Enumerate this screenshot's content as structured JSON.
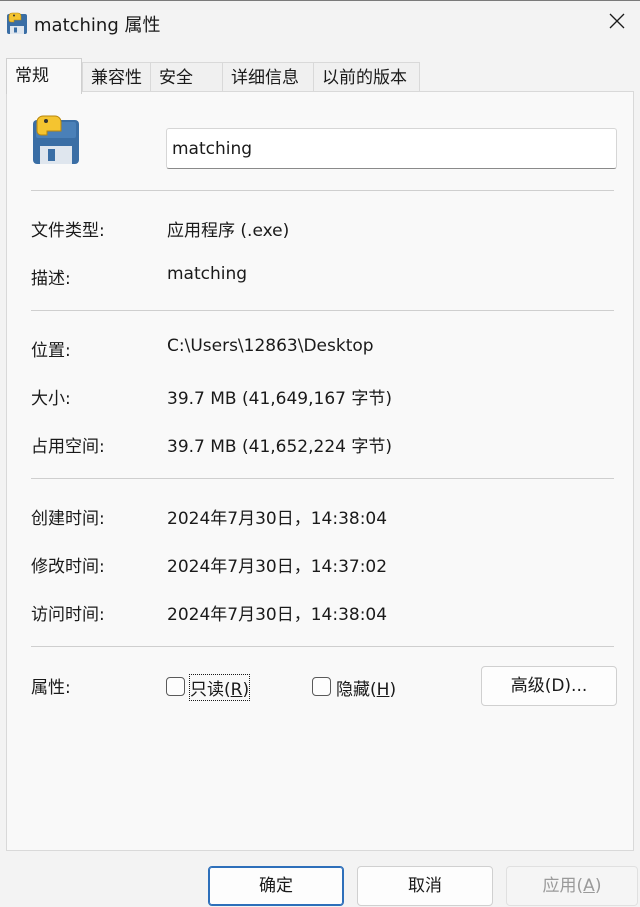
{
  "window": {
    "title": "matching 属性"
  },
  "tabs": [
    {
      "label": "常规",
      "active": true
    },
    {
      "label": "兼容性",
      "active": false
    },
    {
      "label": "安全",
      "active": false
    },
    {
      "label": "详细信息",
      "active": false
    },
    {
      "label": "以前的版本",
      "active": false
    }
  ],
  "general": {
    "file_name": "matching",
    "file_type_label": "文件类型:",
    "file_type_value": "应用程序 (.exe)",
    "description_label": "描述:",
    "description_value": "matching",
    "location_label": "位置:",
    "location_value": "C:\\Users\\12863\\Desktop",
    "size_label": "大小:",
    "size_value": "39.7 MB (41,649,167 字节)",
    "size_on_disk_label": "占用空间:",
    "size_on_disk_value": "39.7 MB (41,652,224 字节)",
    "created_label": "创建时间:",
    "created_value": "2024年7月30日，14:38:04",
    "modified_label": "修改时间:",
    "modified_value": "2024年7月30日，14:37:02",
    "accessed_label": "访问时间:",
    "accessed_value": "2024年7月30日，14:38:04",
    "attributes_label": "属性:",
    "readonly_label": "只读(",
    "readonly_key": "R",
    "readonly_end": ")",
    "readonly_checked": false,
    "hidden_label": "隐藏(",
    "hidden_key": "H",
    "hidden_end": ")",
    "hidden_checked": false,
    "advanced_button": "高级(D)..."
  },
  "footer": {
    "ok_label": "确定",
    "cancel_label": "取消",
    "apply_label": "应用(",
    "apply_key": "A",
    "apply_end": ")"
  },
  "icons": {
    "title": "python-file-icon",
    "app": "python-file-icon",
    "close": "close-icon"
  },
  "colors": {
    "accent": "#2d6fba",
    "disabled_text": "#9a9a9a"
  }
}
